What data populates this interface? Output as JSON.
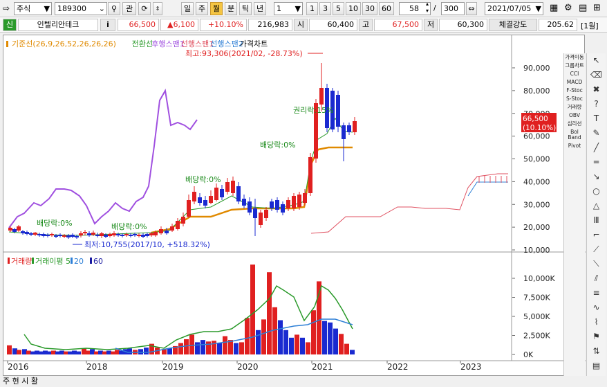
{
  "toolbar": {
    "market": "주식",
    "code": "189300",
    "btn_search_label": "관",
    "periods": [
      "일",
      "주",
      "월",
      "분",
      "틱",
      "년"
    ],
    "active_period": "월",
    "period_value": "1",
    "minute_options": [
      "1",
      "3",
      "5",
      "10",
      "30",
      "60"
    ],
    "count_value": "58",
    "count_total": "300",
    "date": "2021/07/05",
    "icons": [
      "search-icon",
      "chevron-up-icon",
      "chevron-down-icon",
      "dropdown-icon",
      "calendar-icon",
      "grid-icon",
      "settings-icon",
      "tile-icon",
      "close-icon"
    ]
  },
  "quote": {
    "tag": "신",
    "name": "인텔리안테크",
    "info_label": "i",
    "price": "66,500",
    "change": "▲6,100",
    "change_pct": "+10.10%",
    "volume": "216,983",
    "open_label": "시",
    "open": "60,400",
    "high_label": "고",
    "high": "67,500",
    "low_label": "저",
    "low": "60,300",
    "strength_label": "체결강도",
    "strength": "205.62",
    "period_tag": "[1월]"
  },
  "legend": {
    "items": [
      {
        "label": "기준선(26,9,26,52,26,26,26)",
        "color": "#e08a00"
      },
      {
        "label": "전환선",
        "color": "#2b9a2b"
      },
      {
        "label": "후행스팬1",
        "color": "#a050e0"
      },
      {
        "label": "선행스팬1",
        "color": "#e05060"
      },
      {
        "label": "선행스팬2",
        "color": "#2d7fd6"
      },
      {
        "label": "가격차트",
        "color": "#000000"
      }
    ]
  },
  "volume_legend": {
    "items": [
      {
        "label": "거래량",
        "color": "#e02020"
      },
      {
        "label": "거래이평 5",
        "color": "#2b9a2b"
      },
      {
        "label": "20",
        "color": "#2d7fd6"
      },
      {
        "label": "60",
        "color": "#1a1aa0"
      }
    ]
  },
  "annotations": {
    "high": "최고:93,306(2021/02, -28.73%)",
    "low": "최저:10,755(2017/10, +518.32%)",
    "div1": "배당락:0%",
    "div2": "배당락:0%",
    "div3": "배당락:0%",
    "div4": "배당락:0%",
    "rights": "권리락:15%"
  },
  "price_axis": [
    "90,000",
    "80,000",
    "70,000",
    "60,000",
    "50,000",
    "40,000",
    "30,000",
    "20,000",
    "10,000"
  ],
  "last_price_tag": {
    "price": "66,500",
    "pct": "(10.10%)"
  },
  "volume_axis": [
    "10,000K",
    "7,500K",
    "5,000K",
    "2,500K",
    "0K"
  ],
  "x_axis": [
    "2016",
    "2018",
    "2019",
    "2020",
    "2021",
    "2022",
    "2023"
  ],
  "side_panel": [
    "가격이동",
    "그룹차트",
    "CCI",
    "MACD",
    "F-Stoc",
    "S-Stoc",
    "거래량",
    "OBV",
    "심리선",
    "Bol Band",
    "Pivot"
  ],
  "bottom_tabs": [
    "주",
    "현",
    "시",
    "활"
  ],
  "colors": {
    "up": "#e02020",
    "down": "#1a2ad0"
  }
}
